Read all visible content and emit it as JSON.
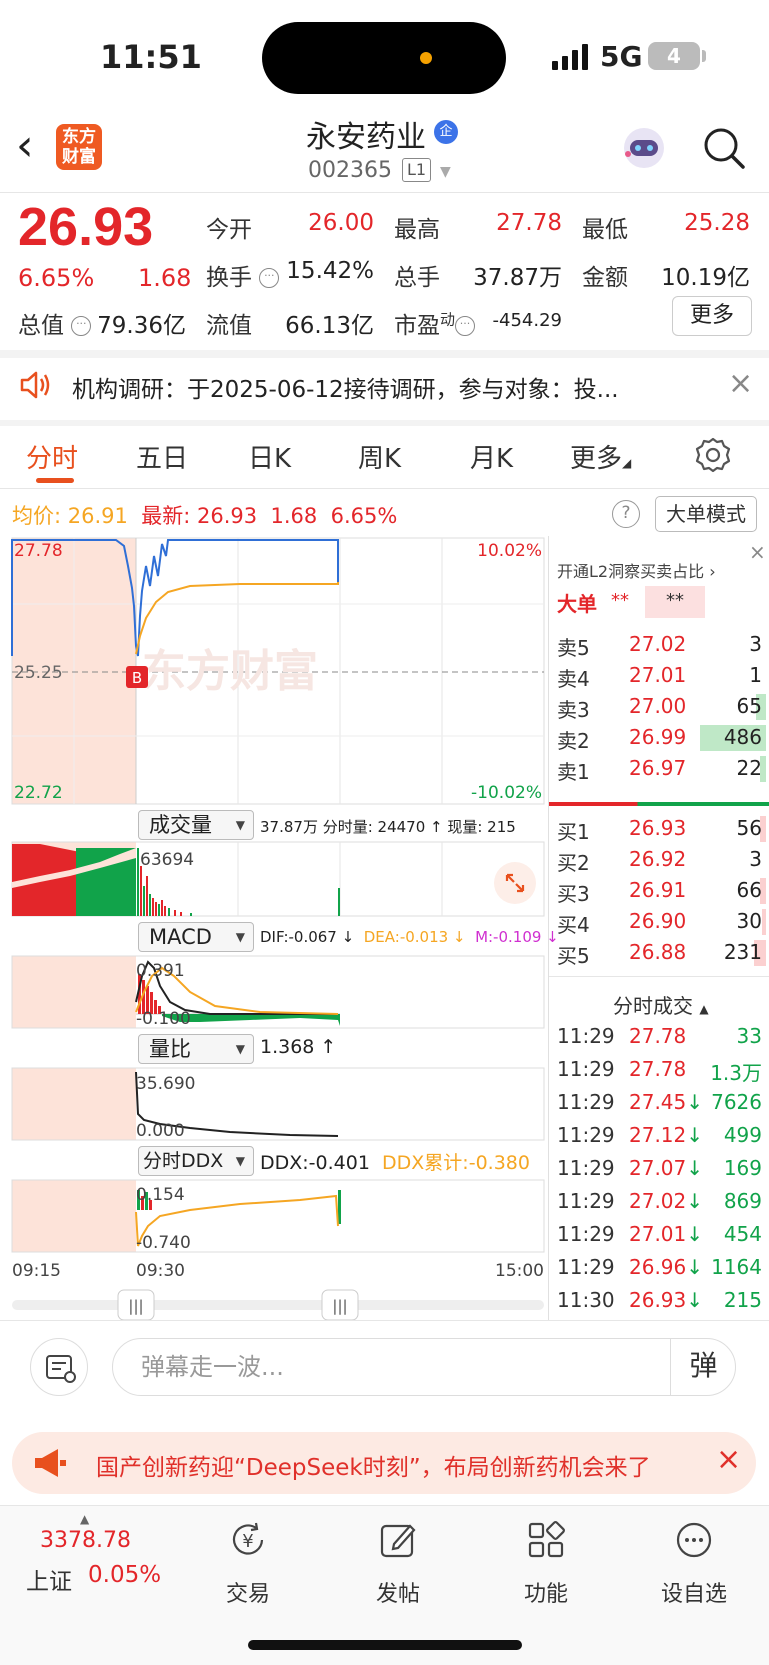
{
  "status": {
    "time": "11:51",
    "network": "5G",
    "battery": "4"
  },
  "header": {
    "logo_line1": "东方",
    "logo_line2": "财富",
    "stock_name": "永安药业",
    "qi_badge": "企",
    "stock_code": "002365",
    "level_badge": "L1"
  },
  "quote": {
    "price": "26.93",
    "pct": "6.65%",
    "change": "1.68",
    "open_label": "今开",
    "open": "26.00",
    "high_label": "最高",
    "high": "27.78",
    "low_label": "最低",
    "low": "25.28",
    "turnover_label": "换手",
    "turnover": "15.42%",
    "volume_label": "总手",
    "volume": "37.87万",
    "amount_label": "金额",
    "amount": "10.19亿",
    "mktcap_label": "总值",
    "mktcap": "79.36亿",
    "float_label": "流值",
    "float": "66.13亿",
    "pe_label": "市盈",
    "pe_sup": "动",
    "pe": "-454.29",
    "more_label": "更多"
  },
  "notice": {
    "text": "机构调研：于2025-06-12接待调研，参与对象：投..."
  },
  "tabs": [
    "分时",
    "五日",
    "日K",
    "周K",
    "月K",
    "更多"
  ],
  "infoline": {
    "avg_label": "均价:",
    "avg": "26.91",
    "latest_label": "最新:",
    "latest": "26.93",
    "change": "1.68",
    "pct": "6.65%",
    "help": "?",
    "bigmode_label": "大单模式"
  },
  "chart": {
    "price_top": "27.78",
    "price_mid": "25.25",
    "price_bottom": "22.72",
    "pct_top": "10.02%",
    "pct_bottom": "-10.02%",
    "watermark": "东方财富",
    "b_marker": "B",
    "volume_select": "成交量",
    "volume_info": "37.87万 分时量: 24470 ↑ 现量: 215",
    "volume_max": "63694",
    "macd_select": "MACD",
    "dif": "DIF:-0.067 ↓",
    "dea": "DEA:-0.013 ↓",
    "m": "M:-0.109 ↓",
    "macd_top": "0.391",
    "macd_bottom": "-0.100",
    "lb_select": "量比",
    "lb_value": "1.368 ↑",
    "lb_top": "35.690",
    "lb_bottom": "0.000",
    "ddx_select": "分时DDX",
    "ddx": "DDX:-0.401",
    "ddx_sum": "DDX累计:-0.380",
    "ddx_top": "0.154",
    "ddx_bottom": "-0.740",
    "x_start": "09:15",
    "x_mid": "09:30",
    "x_end": "15:00",
    "scroll_handle": "|||"
  },
  "book": {
    "promo": "开通L2洞察买卖占比",
    "big_label": "大单",
    "big_stars1": "**",
    "big_stars2": "**",
    "asks": [
      {
        "label": "卖5",
        "price": "27.02",
        "vol": "3"
      },
      {
        "label": "卖4",
        "price": "27.01",
        "vol": "1"
      },
      {
        "label": "卖3",
        "price": "27.00",
        "vol": "65"
      },
      {
        "label": "卖2",
        "price": "26.99",
        "vol": "486"
      },
      {
        "label": "卖1",
        "price": "26.97",
        "vol": "22"
      }
    ],
    "bids": [
      {
        "label": "买1",
        "price": "26.93",
        "vol": "56"
      },
      {
        "label": "买2",
        "price": "26.92",
        "vol": "3"
      },
      {
        "label": "买3",
        "price": "26.91",
        "vol": "66"
      },
      {
        "label": "买4",
        "price": "26.90",
        "vol": "30"
      },
      {
        "label": "买5",
        "price": "26.88",
        "vol": "231"
      }
    ],
    "trades_title": "分时成交",
    "trades": [
      {
        "time": "11:29",
        "price": "27.78",
        "vol": "33"
      },
      {
        "time": "11:29",
        "price": "27.78",
        "vol": "1.3万"
      },
      {
        "time": "11:29",
        "price": "27.45↓",
        "vol": "7626"
      },
      {
        "time": "11:29",
        "price": "27.12↓",
        "vol": "499"
      },
      {
        "time": "11:29",
        "price": "27.07↓",
        "vol": "169"
      },
      {
        "time": "11:29",
        "price": "27.02↓",
        "vol": "869"
      },
      {
        "time": "11:29",
        "price": "27.01↓",
        "vol": "454"
      },
      {
        "time": "11:29",
        "price": "26.96↓",
        "vol": "1164"
      },
      {
        "time": "11:30",
        "price": "26.93↓",
        "vol": "215"
      }
    ]
  },
  "danmu": {
    "placeholder": "弹幕走一波...",
    "button": "弹"
  },
  "promo": {
    "text": "国产创新药迎“DeepSeek时刻”，布局创新药机会来了"
  },
  "tabbar": {
    "index_value": "3378.78",
    "index_name": "上证",
    "index_pct": "0.05%",
    "items": [
      "交易",
      "发帖",
      "功能",
      "设自选"
    ]
  },
  "colors": {
    "up": "#e3262a",
    "down": "#11a34a",
    "avg": "#f5a623",
    "price_line": "#2f6fd6",
    "accent": "#e8501e"
  }
}
